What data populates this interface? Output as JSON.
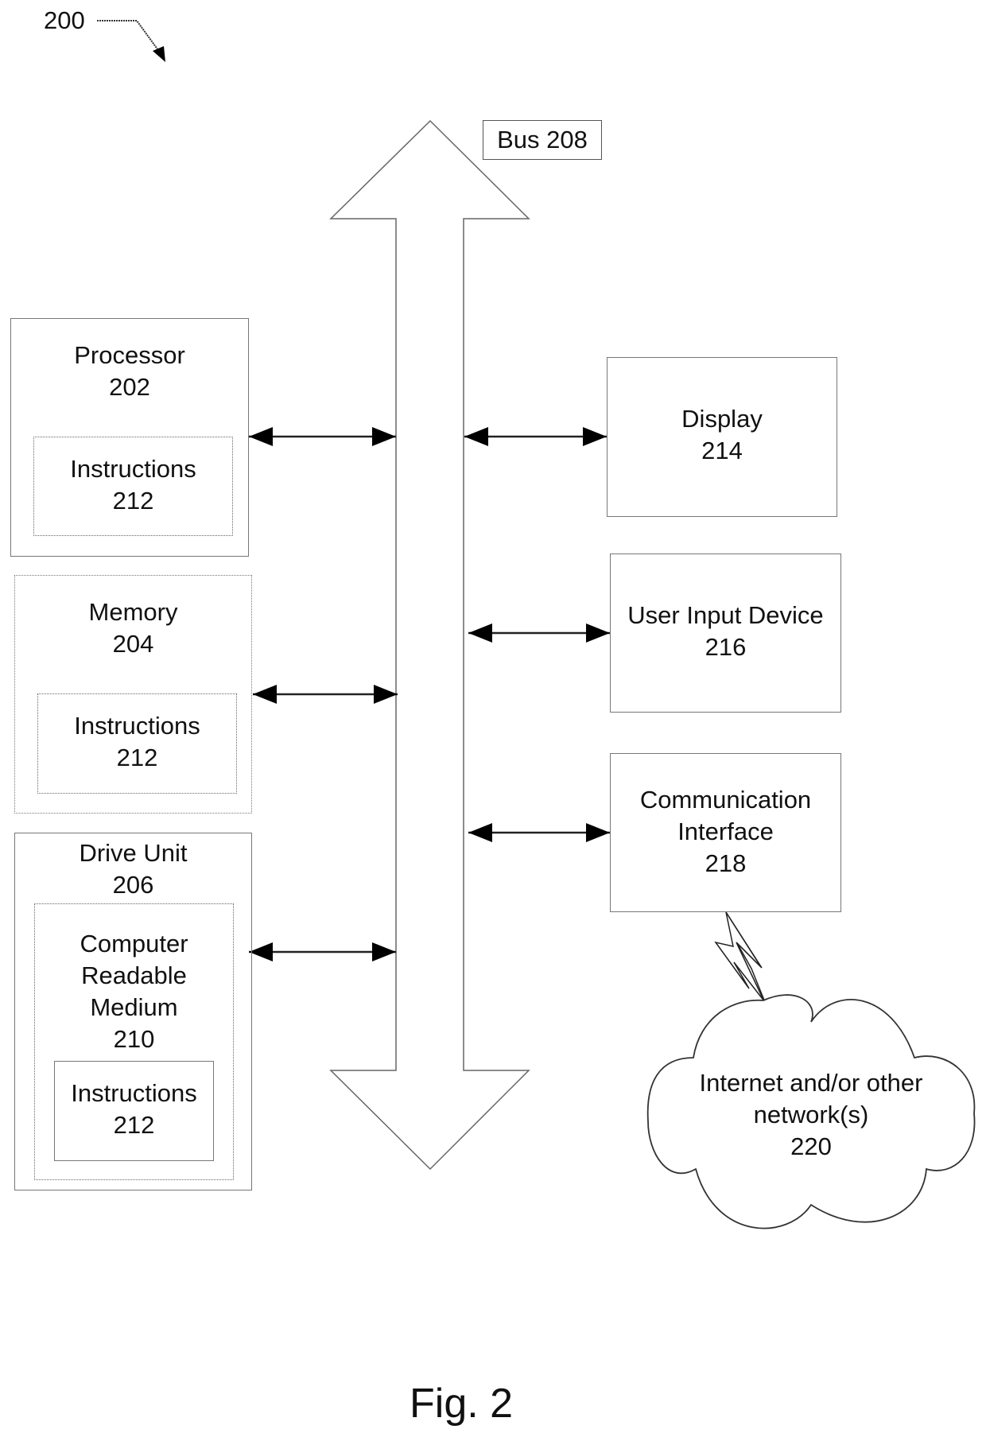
{
  "figure": {
    "reference_numeral": "200",
    "caption": "Fig. 2"
  },
  "bus": {
    "label": "Bus 208"
  },
  "left_components": {
    "processor": {
      "name": "Processor",
      "number": "202",
      "inner": {
        "name": "Instructions",
        "number": "212"
      }
    },
    "memory": {
      "name": "Memory",
      "number": "204",
      "inner": {
        "name": "Instructions",
        "number": "212"
      }
    },
    "drive_unit": {
      "name": "Drive Unit",
      "number": "206",
      "medium": {
        "line1": "Computer",
        "line2": "Readable",
        "line3": "Medium",
        "number": "210",
        "inner": {
          "name": "Instructions",
          "number": "212"
        }
      }
    }
  },
  "right_components": {
    "display": {
      "name": "Display",
      "number": "214"
    },
    "user_input": {
      "name": "User Input Device",
      "number": "216"
    },
    "comm_interface": {
      "line1": "Communication",
      "line2": "Interface",
      "number": "218"
    }
  },
  "network": {
    "line1": "Internet and/or other",
    "line2": "network(s)",
    "number": "220"
  }
}
